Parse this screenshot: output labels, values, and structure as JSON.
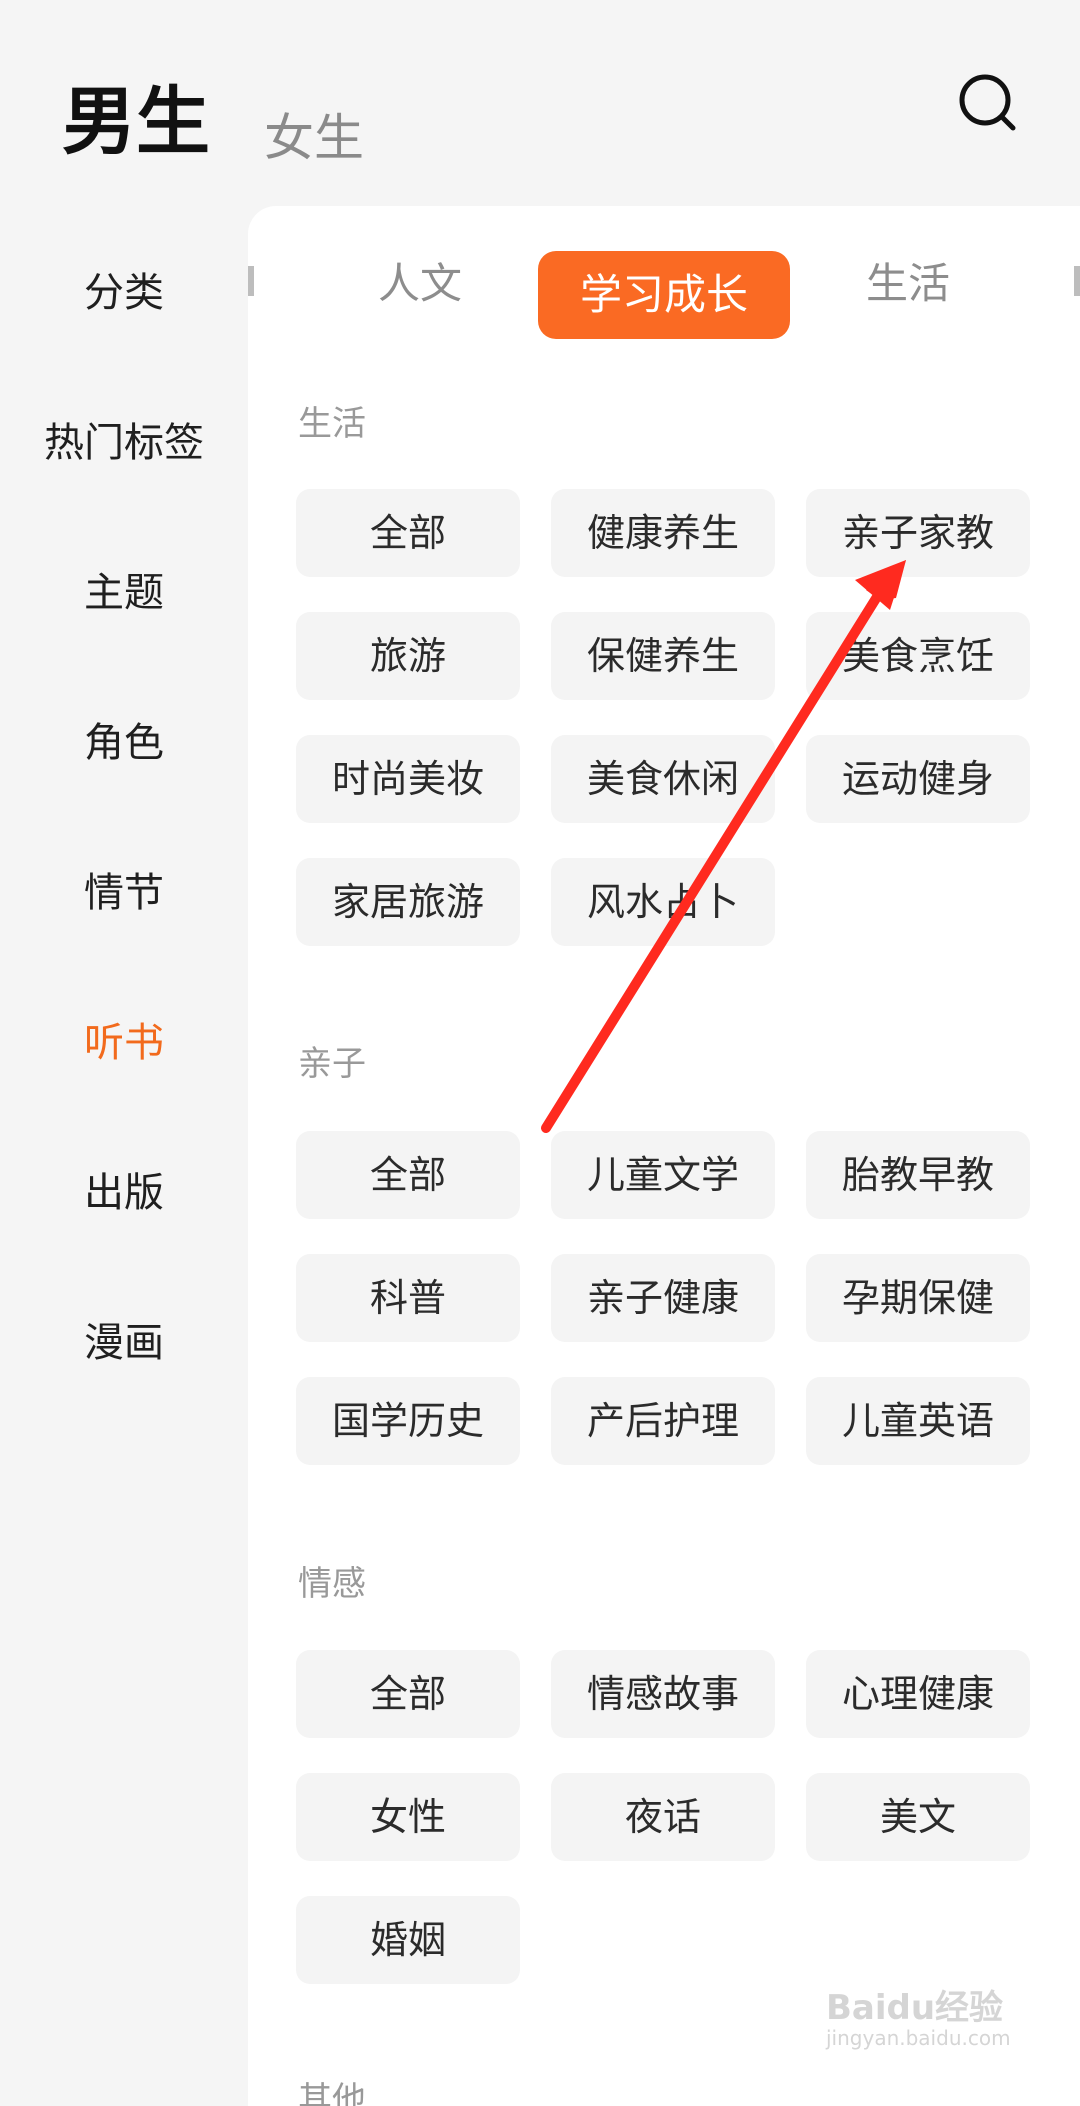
{
  "header": {
    "tab_active": "男生",
    "tab_inactive": "女生",
    "search_icon": "search-icon"
  },
  "sidebar": {
    "items": [
      "分类",
      "热门标签",
      "主题",
      "角色",
      "情节",
      "听书",
      "出版",
      "漫画"
    ],
    "active_index": 5
  },
  "subtabs": {
    "items": [
      "人文",
      "学习成长",
      "生活"
    ],
    "active_index": 1
  },
  "sections": [
    {
      "title": "生活",
      "chips": [
        "全部",
        "健康养生",
        "亲子家教",
        "旅游",
        "保健养生",
        "美食烹饪",
        "时尚美妆",
        "美食休闲",
        "运动健身",
        "家居旅游",
        "风水占卜"
      ]
    },
    {
      "title": "亲子",
      "chips": [
        "全部",
        "儿童文学",
        "胎教早教",
        "科普",
        "亲子健康",
        "孕期保健",
        "国学历史",
        "产后护理",
        "儿童英语"
      ]
    },
    {
      "title": "情感",
      "chips": [
        "全部",
        "情感故事",
        "心理健康",
        "女性",
        "夜话",
        "美文",
        "婚姻"
      ]
    },
    {
      "title": "其他"
    }
  ],
  "watermark": {
    "logo": "Baidu经验",
    "url": "jingyan.baidu.com"
  },
  "colors": {
    "accent": "#fa6a23",
    "active_text": "#f26a1c",
    "annotation_arrow": "#ff2a1f"
  }
}
